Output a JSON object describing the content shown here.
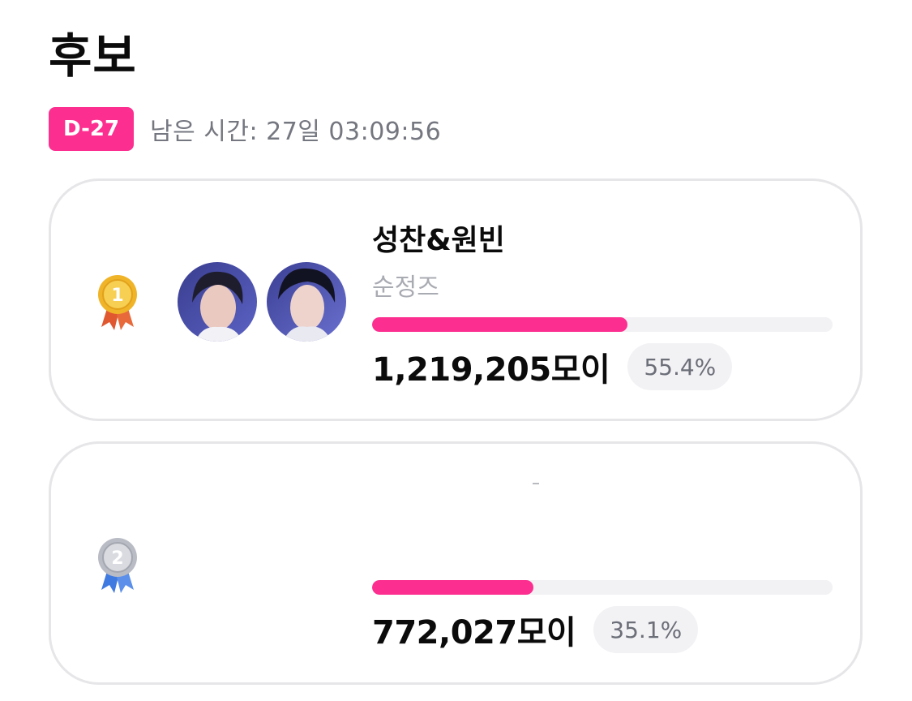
{
  "header": {
    "title": "후보"
  },
  "timer": {
    "badge": "D-27",
    "text": "남은 시간: 27일 03:09:56"
  },
  "candidates": [
    {
      "rank": "1",
      "name": "성찬&원빈",
      "subtitle": "순정즈",
      "votes": "1,219,205모이",
      "percent": "55.4%",
      "share": 0.554,
      "medal_color": "gold",
      "ribbon_color": "#e0582f"
    },
    {
      "rank": "2",
      "name": "",
      "subtitle": "",
      "votes": "772,027모이",
      "percent": "35.1%",
      "share": 0.351,
      "medal_color": "silver",
      "ribbon_color": "#3f7ae0"
    }
  ],
  "colors": {
    "accent": "#fc2e8f",
    "track": "#f2f2f5",
    "muted_text": "#757780"
  }
}
